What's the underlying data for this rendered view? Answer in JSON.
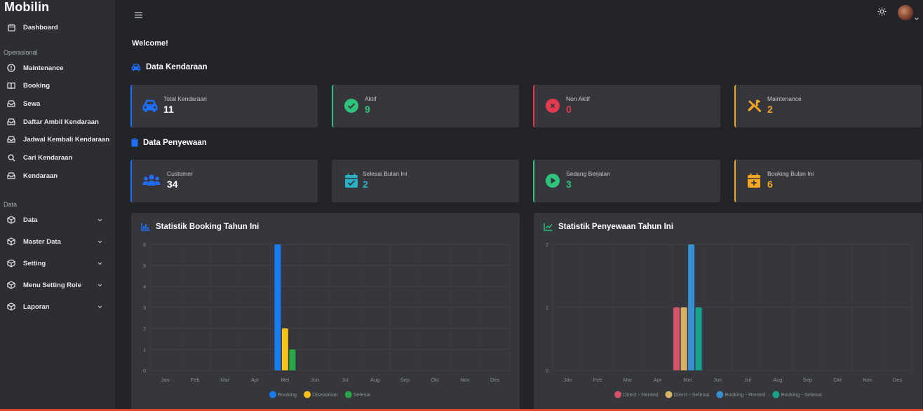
{
  "app": {
    "brand": "Mobilin"
  },
  "sidebar": {
    "dashboard": {
      "label": "Dashboard",
      "icon": "calendar-icon"
    },
    "sections": [
      {
        "header": "Operasional"
      },
      {
        "header": "Data"
      }
    ],
    "operasional": [
      {
        "label": "Maintenance",
        "icon": "info-circle-icon"
      },
      {
        "label": "Booking",
        "icon": "book-icon"
      },
      {
        "label": "Sewa",
        "icon": "inbox-icon"
      },
      {
        "label": "Daftar Ambil Kendaraan",
        "icon": "inbox-icon"
      },
      {
        "label": "Jadwal Kembali Kendaraan",
        "icon": "inbox-icon"
      },
      {
        "label": "Cari Kendaraan",
        "icon": "search-icon"
      },
      {
        "label": "Kendaraan",
        "icon": "inbox-icon"
      }
    ],
    "data": [
      {
        "label": "Data",
        "icon": "cube-icon"
      },
      {
        "label": "Master Data",
        "icon": "cube-icon"
      },
      {
        "label": "Setting",
        "icon": "cube-icon"
      },
      {
        "label": "Menu Setting Role",
        "icon": "cube-icon"
      },
      {
        "label": "Laporan",
        "icon": "cube-icon"
      }
    ]
  },
  "main": {
    "welcome": "Welcome!",
    "kendaraan_title": "Data Kendaraan",
    "kendaraan_cards": [
      {
        "label": "Total Kendaraan",
        "value": "11",
        "color": "#1f6fff",
        "icon": "car-icon"
      },
      {
        "label": "Aktif",
        "value": "9",
        "color": "#2fc27a",
        "icon": "check-circle-icon"
      },
      {
        "label": "Non Aktif",
        "value": "0",
        "color": "#e53950",
        "icon": "x-circle-icon"
      },
      {
        "label": "Maintenance",
        "value": "2",
        "color": "#f5a623",
        "icon": "tools-icon"
      }
    ],
    "penyewaan_title": "Data Penyewaan",
    "penyewaan_cards": [
      {
        "label": "Customer",
        "value": "34",
        "color": "#1f6fff",
        "icon": "users-icon"
      },
      {
        "label": "Selesai Bulan Ini",
        "value": "2",
        "color": "#2ab0c5",
        "icon": "calendar-check-icon"
      },
      {
        "label": "Sedang Berjalan",
        "value": "3",
        "color": "#2fc27a",
        "icon": "play-circle-icon"
      },
      {
        "label": "Booking Bulan Ini",
        "value": "6",
        "color": "#f5a623",
        "icon": "calendar-plus-icon"
      }
    ]
  },
  "chart_data": [
    {
      "type": "bar",
      "title": "Statistik Booking Tahun Ini",
      "categories": [
        "Jan",
        "Feb",
        "Mar",
        "Apr",
        "Mei",
        "Jun",
        "Jul",
        "Aug",
        "Sep",
        "Okt",
        "Nov",
        "Des"
      ],
      "ylim": [
        0,
        6
      ],
      "yticks": [
        "0",
        "1",
        "2",
        "3",
        "4",
        "5",
        "6"
      ],
      "grid": true,
      "legend": "bottom",
      "series": [
        {
          "name": "Booking",
          "color": "#1a7cf5",
          "values": [
            0,
            0,
            0,
            0,
            6,
            0,
            0,
            0,
            0,
            0,
            0,
            0
          ]
        },
        {
          "name": "Disewakan",
          "color": "#f6c21a",
          "values": [
            0,
            0,
            0,
            0,
            2,
            0,
            0,
            0,
            0,
            0,
            0,
            0
          ]
        },
        {
          "name": "Selesai",
          "color": "#28a745",
          "values": [
            0,
            0,
            0,
            0,
            1,
            0,
            0,
            0,
            0,
            0,
            0,
            0
          ]
        }
      ]
    },
    {
      "type": "bar",
      "title": "Statistik Penyewaan Tahun Ini",
      "categories": [
        "Jan",
        "Feb",
        "Mar",
        "Apr",
        "Mei",
        "Jun",
        "Jul",
        "Aug",
        "Sep",
        "Okt",
        "Nov",
        "Des"
      ],
      "ylim": [
        0,
        2
      ],
      "yticks": [
        "0",
        "1",
        "2"
      ],
      "grid": true,
      "legend": "bottom",
      "series": [
        {
          "name": "Direct - Rented",
          "color": "#d4536b",
          "values": [
            0,
            0,
            0,
            0,
            1,
            0,
            0,
            0,
            0,
            0,
            0,
            0
          ]
        },
        {
          "name": "Direct - Selesai",
          "color": "#d9b365",
          "values": [
            0,
            0,
            0,
            0,
            1,
            0,
            0,
            0,
            0,
            0,
            0,
            0
          ]
        },
        {
          "name": "Booking - Rented",
          "color": "#3a8fd0",
          "values": [
            0,
            0,
            0,
            0,
            2,
            0,
            0,
            0,
            0,
            0,
            0,
            0
          ]
        },
        {
          "name": "Booking - Selesai",
          "color": "#16a58a",
          "values": [
            0,
            0,
            0,
            0,
            1,
            0,
            0,
            0,
            0,
            0,
            0,
            0
          ]
        }
      ]
    }
  ]
}
